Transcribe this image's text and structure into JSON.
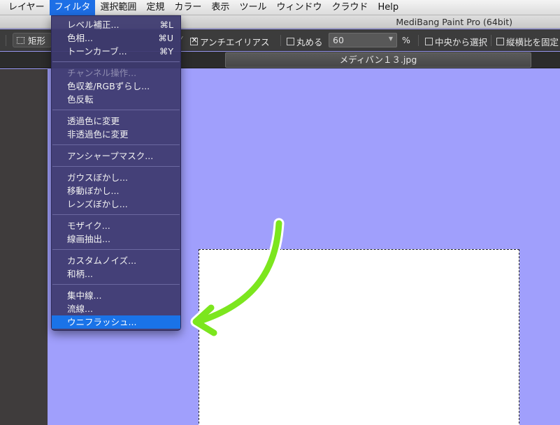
{
  "menubar": {
    "items": [
      "レイヤー",
      "フィルタ",
      "選択範囲",
      "定規",
      "カラー",
      "表示",
      "ツール",
      "ウィンドウ",
      "クラウド",
      "Help"
    ],
    "active": "フィルタ"
  },
  "window": {
    "title": "MediBang Paint Pro (64bit)"
  },
  "toolbar": {
    "shape_label": "矩形",
    "antialias_label": "アンチエイリアス",
    "antialias_checked": true,
    "round_label": "丸める",
    "round_checked": false,
    "round_value": "60",
    "percent_label": "%",
    "center_select_label": "中央から選択",
    "center_select_checked": false,
    "fixed_ratio_label": "縦横比を固定",
    "fixed_ratio_checked": false
  },
  "document": {
    "tab_name": "メディバン１３.jpg"
  },
  "filter_menu": {
    "items": [
      {
        "label": "レベル補正...",
        "shortcut": "⌘L"
      },
      {
        "label": "色相...",
        "shortcut": "⌘U"
      },
      {
        "label": "トーンカーブ...",
        "shortcut": "⌘Y"
      },
      {
        "label": "チャンネル操作...",
        "shortcut": "",
        "disabled": true
      },
      {
        "label": "色収差/RGBずらし...",
        "shortcut": ""
      },
      {
        "label": "色反転",
        "shortcut": ""
      },
      {
        "label": "透過色に変更",
        "shortcut": ""
      },
      {
        "label": "非透過色に変更",
        "shortcut": ""
      },
      {
        "label": "アンシャープマスク...",
        "shortcut": ""
      },
      {
        "label": "ガウスぼかし...",
        "shortcut": ""
      },
      {
        "label": "移動ぼかし...",
        "shortcut": ""
      },
      {
        "label": "レンズぼかし...",
        "shortcut": ""
      },
      {
        "label": "モザイク...",
        "shortcut": ""
      },
      {
        "label": "線画抽出...",
        "shortcut": ""
      },
      {
        "label": "カスタムノイズ...",
        "shortcut": ""
      },
      {
        "label": "和柄...",
        "shortcut": ""
      },
      {
        "label": "集中線...",
        "shortcut": ""
      },
      {
        "label": "流線...",
        "shortcut": ""
      },
      {
        "label": "ウニフラッシュ...",
        "shortcut": "",
        "selected": true
      }
    ]
  },
  "colors": {
    "canvas_background": "#a09ffc",
    "menu_highlight": "#1a73e8",
    "annotation_arrow": "#7ce61e"
  }
}
